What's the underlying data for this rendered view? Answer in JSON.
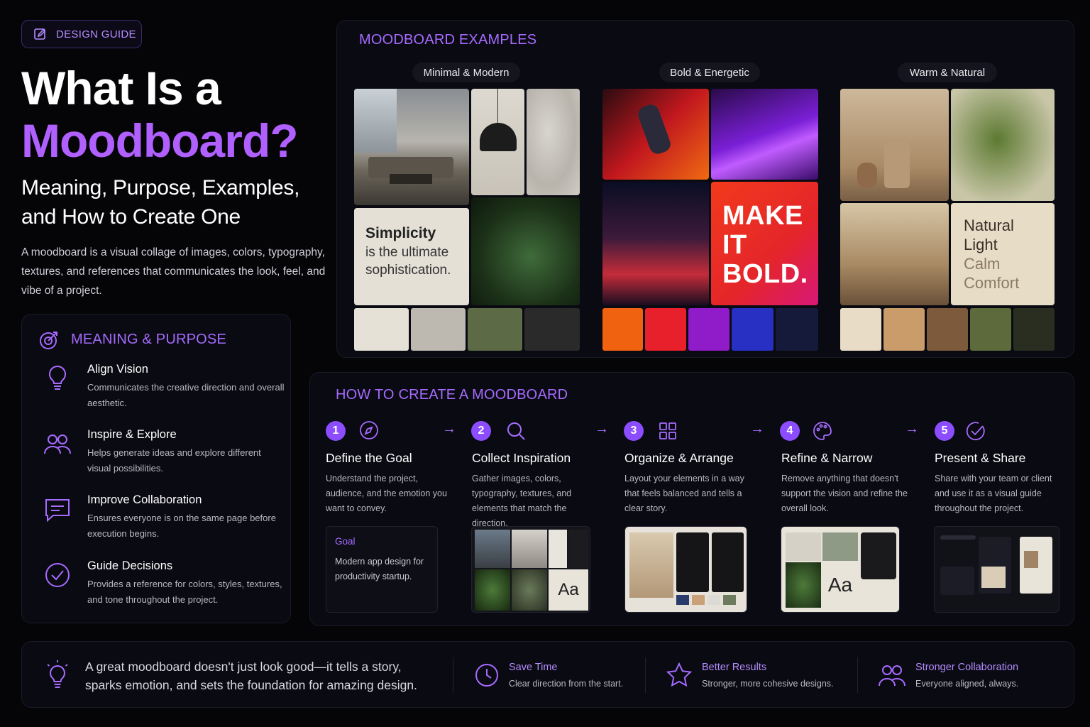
{
  "badge": {
    "label": "DESIGN GUIDE"
  },
  "hero": {
    "title_line1": "What Is a",
    "title_line2": "Moodboard?",
    "subtitle": "Meaning, Purpose, Examples, and How to Create One",
    "description": "A moodboard is a visual collage of images, colors, typography, textures, and references that communicates the look, feel, and vibe of a project."
  },
  "meaning": {
    "title": "MEANING & PURPOSE",
    "items": [
      {
        "title": "Align Vision",
        "desc": "Communicates the creative direction and overall aesthetic.",
        "icon": "lightbulb-icon"
      },
      {
        "title": "Inspire & Explore",
        "desc": "Helps generate ideas and explore different visual possibilities.",
        "icon": "users-icon"
      },
      {
        "title": "Improve Collaboration",
        "desc": "Ensures everyone is on the same page before execution begins.",
        "icon": "chat-icon"
      },
      {
        "title": "Guide Decisions",
        "desc": "Provides a reference for colors, styles, textures, and tone throughout the project.",
        "icon": "check-circle-icon"
      }
    ]
  },
  "examples": {
    "title": "MOODBOARD EXAMPLES",
    "boards": [
      {
        "label": "Minimal & Modern",
        "quote_bold": "Simplicity",
        "quote_rest": "is the ultimate sophistication.",
        "swatches": [
          "#e6e1d6",
          "#bdb9b1",
          "#5c6b45",
          "#2a2a2a"
        ]
      },
      {
        "label": "Bold & Energetic",
        "quote": "MAKE IT BOLD.",
        "swatches": [
          "#f0620f",
          "#e8202c",
          "#8f1cc8",
          "#2830c4",
          "#161a3a"
        ]
      },
      {
        "label": "Warm & Natural",
        "quote_line1": "Natural",
        "quote_line2": "Light",
        "quote_line3": "Calm",
        "quote_line4": "Comfort",
        "swatches": [
          "#e8dcc6",
          "#c99c6a",
          "#7d5a3c",
          "#5d6b3c",
          "#2a2e20"
        ]
      }
    ]
  },
  "howto": {
    "title": "HOW TO CREATE A MOODBOARD",
    "steps": [
      {
        "num": "1",
        "title": "Define the Goal",
        "desc": "Understand the project, audience, and the emotion you want to convey.",
        "icon": "compass-icon"
      },
      {
        "num": "2",
        "title": "Collect Inspiration",
        "desc": "Gather images, colors, typography, textures, and elements that match the direction.",
        "icon": "search-icon"
      },
      {
        "num": "3",
        "title": "Organize & Arrange",
        "desc": "Layout your elements in a way that feels balanced and tells a clear story.",
        "icon": "grid-icon"
      },
      {
        "num": "4",
        "title": "Refine & Narrow",
        "desc": "Remove anything that doesn't support the vision and refine the overall look.",
        "icon": "palette-icon"
      },
      {
        "num": "5",
        "title": "Present & Share",
        "desc": "Share with your team or client and use it as a visual guide throughout the project.",
        "icon": "check-icon"
      }
    ],
    "goal_card": {
      "label": "Goal",
      "text": "Modern app design for productivity startup."
    },
    "type_sample": "Aa",
    "arrow": "→"
  },
  "footer": {
    "quote": "A great moodboard doesn't just look good—it tells a story, sparks emotion, and sets the foundation for amazing design.",
    "benefits": [
      {
        "title": "Save Time",
        "desc": "Clear direction from the start.",
        "icon": "clock-icon"
      },
      {
        "title": "Better Results",
        "desc": "Stronger, more cohesive designs.",
        "icon": "star-icon"
      },
      {
        "title": "Stronger Collaboration",
        "desc": "Everyone aligned, always.",
        "icon": "users-icon"
      }
    ]
  },
  "colors": {
    "accent": "#a66bff",
    "accent_strong": "#8b4dff",
    "background": "#050508"
  }
}
